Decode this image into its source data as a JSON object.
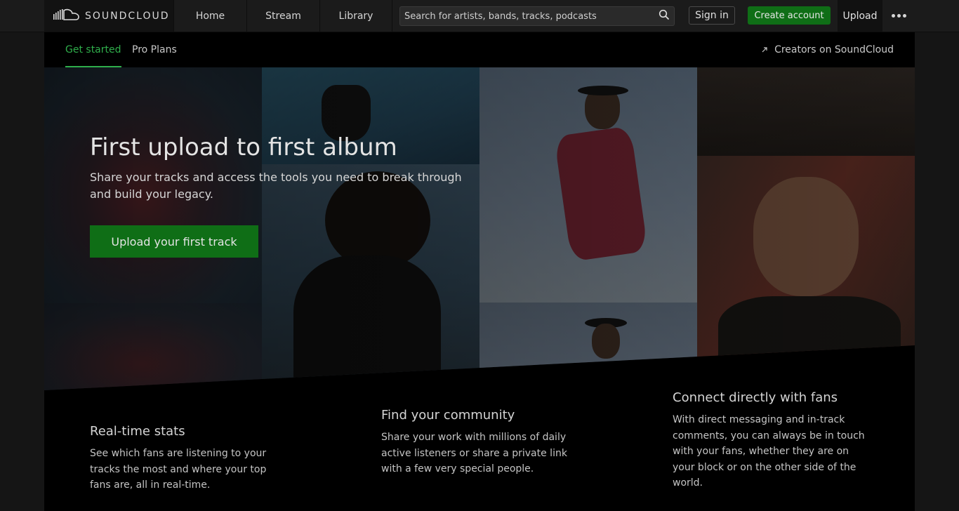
{
  "header": {
    "logo_text": "SOUNDCLOUD",
    "nav": [
      "Home",
      "Stream",
      "Library"
    ],
    "search_placeholder": "Search for artists, bands, tracks, podcasts",
    "sign_in": "Sign in",
    "create_account": "Create account",
    "upload": "Upload"
  },
  "subnav": {
    "tabs": [
      "Get started",
      "Pro Plans"
    ],
    "creators": "Creators on SoundCloud"
  },
  "hero": {
    "title": "First upload to first album",
    "subtitle": "Share your tracks and access the tools you need to break through and build your legacy.",
    "cta": "Upload your first track"
  },
  "features": [
    {
      "title": "Real-time stats",
      "text": "See which fans are listening to your tracks the most and where your top fans are, all in real-time."
    },
    {
      "title": "Find your community",
      "text": "Share your work with millions of daily active listeners or share a private link with a few very special people."
    },
    {
      "title": "Connect directly with fans",
      "text": "With direct messaging and in-track comments, you can always be in touch with your fans, whether they are on your block or on the other side of the world."
    }
  ],
  "colors": {
    "accent_green": "#0f6e16",
    "active_tab": "#2fae4b",
    "background": "#151515"
  },
  "icons": {
    "logo": "soundcloud-logo-icon",
    "search": "search-icon",
    "more": "more-dots-icon",
    "external": "external-link-icon"
  }
}
